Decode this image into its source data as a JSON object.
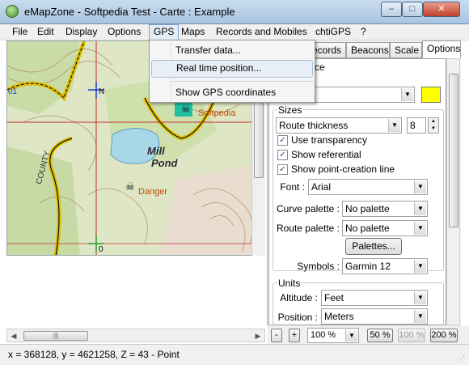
{
  "window": {
    "title": "eMapZone - Softpedia Test - Carte : Example",
    "min_label": "–",
    "max_label": "□",
    "close_label": "✕"
  },
  "menubar": {
    "items": [
      "File",
      "Edit",
      "Display",
      "Options",
      "GPS",
      "Maps",
      "Records and Mobiles",
      "chtiGPS",
      "?"
    ],
    "active": "GPS"
  },
  "gps_menu": {
    "items": [
      "Transfer data...",
      "Real time position...",
      "Show GPS coordinates"
    ],
    "hovered": "Real time position..."
  },
  "map": {
    "labels": {
      "mill": "Mill",
      "pond": "Pond",
      "danger": "Danger",
      "softpedia": "Softpedia",
      "county": "COUNTY",
      "zero": "0",
      "n": "N",
      "one": "01"
    }
  },
  "tabs": {
    "items": [
      "Records",
      "Beacons",
      "Scale",
      "Options"
    ],
    "selected": "Options"
  },
  "options": {
    "appearance_label": "ce",
    "sizes_label": "Sizes",
    "size_select": "Route thickness",
    "size_value": "8",
    "use_transparency": "Use transparency",
    "show_referential": "Show referential",
    "show_point_creation": "Show point-creation line",
    "font_label": "Font :",
    "font_value": "Arial",
    "curve_palette_label": "Curve palette :",
    "curve_palette_value": "No palette",
    "route_palette_label": "Route palette :",
    "route_palette_value": "No palette",
    "palettes_button": "Palettes...",
    "symbols_label": "Symbols :",
    "symbols_value": "Garmin 12",
    "units_label": "Units",
    "altitude_label": "Altitude :",
    "altitude_value": "Feet",
    "position_label": "Position :",
    "position_value": "Meters",
    "swatch_color": "#ffff00"
  },
  "zoom": {
    "minus": "-",
    "plus": "+",
    "zoom_value": "100 %",
    "btn50": "50 %",
    "btn100": "100 %",
    "btn200": "200 %"
  },
  "hscroll": {
    "thumb_grip": "|||"
  },
  "status": {
    "text": "x = 368128, y = 4621258, Z = 43 - Point",
    "grip": "⋰"
  }
}
